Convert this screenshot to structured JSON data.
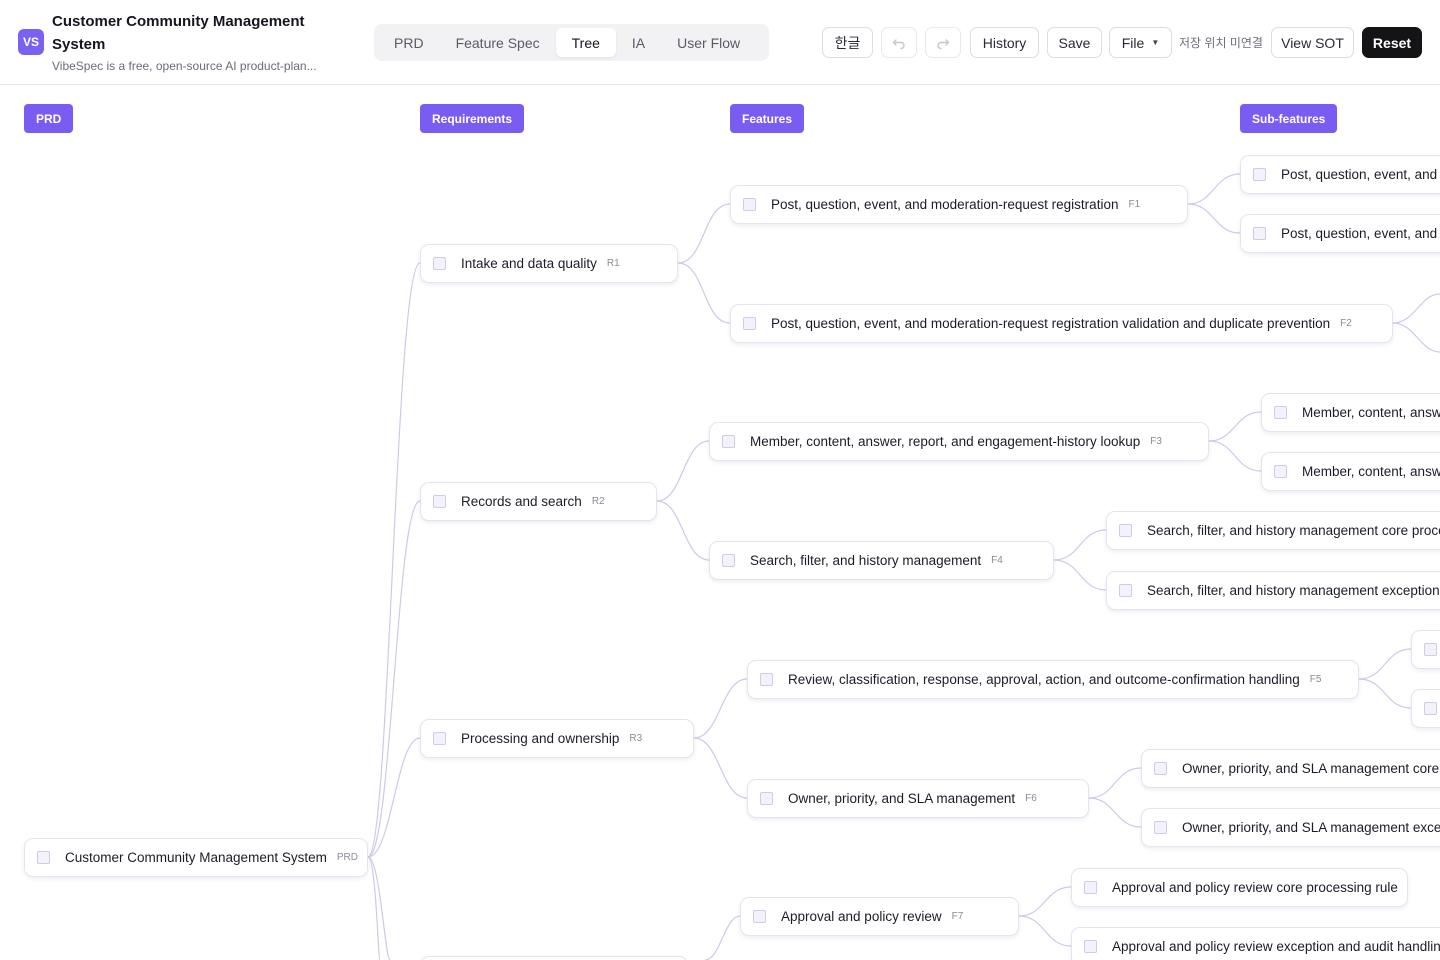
{
  "app": {
    "logo": "VS",
    "title": "Customer Community Management System",
    "subtitle": "VibeSpec is a free, open-source AI product-plan..."
  },
  "tabs": [
    {
      "label": "PRD"
    },
    {
      "label": "Feature Spec"
    },
    {
      "label": "Tree",
      "active": true
    },
    {
      "label": "IA"
    },
    {
      "label": "User Flow"
    }
  ],
  "toolbar": {
    "language": "한글",
    "undo_icon": "undo-icon",
    "redo_icon": "redo-icon",
    "history": "History",
    "save": "Save",
    "file": "File",
    "storage_status": "저장 위치 미연결",
    "view_sot": "View SOT",
    "reset": "Reset"
  },
  "colors": {
    "accent": "#7b5cf2",
    "edge": "#cfc8ea",
    "dark_button": "#141417"
  },
  "columns": [
    {
      "label": "PRD"
    },
    {
      "label": "Requirements"
    },
    {
      "label": "Features"
    },
    {
      "label": "Sub-features"
    }
  ],
  "tree": {
    "prd": {
      "label": "Customer Community Management System",
      "code": "PRD"
    },
    "requirements": [
      {
        "label": "Intake and data quality",
        "code": "R1"
      },
      {
        "label": "Records and search",
        "code": "R2"
      },
      {
        "label": "Processing and ownership",
        "code": "R3"
      }
    ],
    "features": [
      {
        "label": "Post, question, event, and moderation-request registration",
        "code": "F1"
      },
      {
        "label": "Post, question, event, and moderation-request registration validation and duplicate prevention",
        "code": "F2"
      },
      {
        "label": "Member, content, answer, report, and engagement-history lookup",
        "code": "F3"
      },
      {
        "label": "Search, filter, and history management",
        "code": "F4"
      },
      {
        "label": "Review, classification, response, approval, action, and outcome-confirmation handling",
        "code": "F5"
      },
      {
        "label": "Owner, priority, and SLA management",
        "code": "F6"
      },
      {
        "label": "Approval and policy review",
        "code": "F7"
      }
    ],
    "subfeatures": [
      {
        "label": "Post, question, event, and mo"
      },
      {
        "label": "Post, question, event, and mo"
      },
      {
        "label": "Member, content, answer,"
      },
      {
        "label": "Member, content, answer,"
      },
      {
        "label": "Search, filter, and history management core processi"
      },
      {
        "label": "Search, filter, and history management exception and"
      },
      {
        "label": ""
      },
      {
        "label": ""
      },
      {
        "label": "Owner, priority, and SLA management core pro"
      },
      {
        "label": "Owner, priority, and SLA management exceptio"
      },
      {
        "label": "Approval and policy review core processing rule"
      },
      {
        "label": "Approval and policy review exception and audit handling"
      }
    ]
  }
}
